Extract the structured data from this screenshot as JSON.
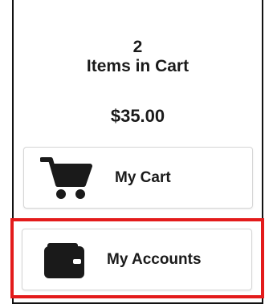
{
  "cart_summary": {
    "item_count": "2",
    "item_label": "Items in Cart",
    "total": "$35.00"
  },
  "buttons": {
    "cart": {
      "label": "My Cart",
      "icon": "shopping-cart-icon"
    },
    "accounts": {
      "label": "My Accounts",
      "icon": "wallet-icon"
    }
  },
  "colors": {
    "highlight": "#e31b1b",
    "icon": "#1a1a1a"
  }
}
